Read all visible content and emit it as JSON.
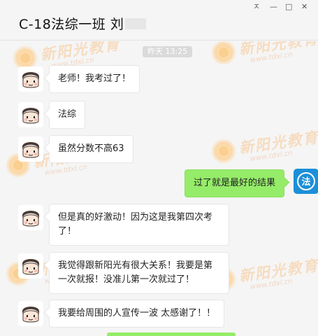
{
  "header": {
    "title": "C-18法综一班 刘",
    "window_controls": [
      "ㅈ",
      "—",
      "□",
      "✕"
    ]
  },
  "watermark": {
    "cn": "新阳光教育",
    "en": "www.tdxl.cn"
  },
  "timestamp": "昨天 13:25",
  "messages": [
    {
      "side": "left",
      "text": "老师！我考过了！"
    },
    {
      "side": "left",
      "text": "法综"
    },
    {
      "side": "left",
      "text": "虽然分数不高63"
    },
    {
      "side": "right",
      "text": "过了就是最好的结果"
    },
    {
      "side": "left",
      "text": "但是真的好激动！因为这是我第四次考了！"
    },
    {
      "side": "left",
      "text": "我觉得跟新阳光有很大关系！我要是第一次就报！没准儿第一次就过了！"
    },
    {
      "side": "left",
      "text": "我要给周围的人宣传一波 太感谢了！！"
    }
  ],
  "law_avatar_glyph": "法",
  "colors": {
    "my_bubble": "#95ec69",
    "law_blue": "#1c8fd8",
    "background": "#f5f5f5"
  }
}
